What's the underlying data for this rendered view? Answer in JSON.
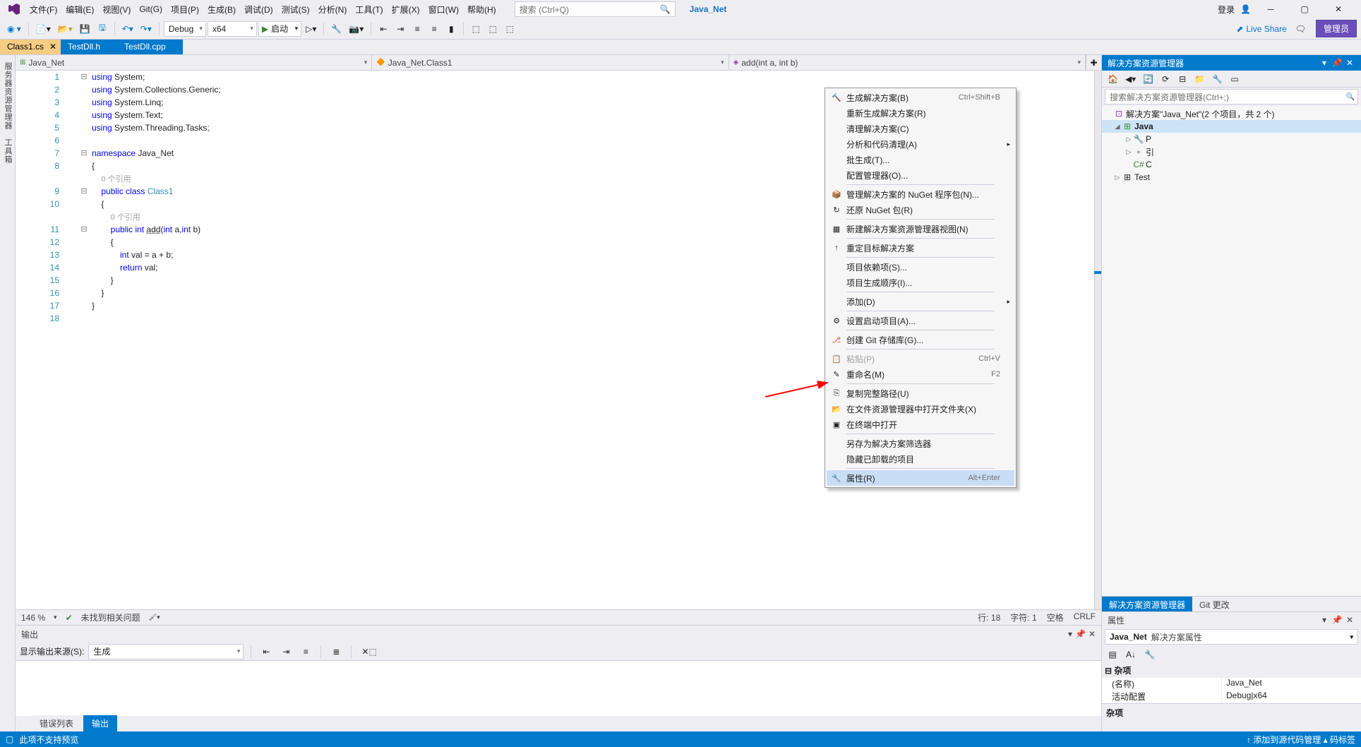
{
  "menu": {
    "file": "文件(F)",
    "edit": "编辑(E)",
    "view": "视图(V)",
    "git": "Git(G)",
    "project": "项目(P)",
    "build": "生成(B)",
    "debug": "调试(D)",
    "test": "测试(S)",
    "analyze": "分析(N)",
    "tools": "工具(T)",
    "extensions": "扩展(X)",
    "window": "窗口(W)",
    "help": "帮助(H)"
  },
  "search_placeholder": "搜索 (Ctrl+Q)",
  "project": "Java_Net",
  "login": "登录",
  "admin": "管理员",
  "live_share": "Live Share",
  "toolbar": {
    "config": "Debug",
    "platform": "x64",
    "start": "启动"
  },
  "tabs": {
    "t1": "Class1.cs",
    "t2": "TestDll.h",
    "t3": "TestDll.cpp"
  },
  "nav": {
    "a": "Java_Net",
    "b": "Java_Net.Class1",
    "c": "add(int a, int b)"
  },
  "code": {
    "l1": "using System;",
    "l2": "using System.Collections.Generic;",
    "l3": "using System.Linq;",
    "l4": "using System.Text;",
    "l5": "using System.Threading.Tasks;",
    "l7": "namespace Java_Net",
    "l8": "{",
    "ref1": "0 个引用",
    "l9": "    public class Class1",
    "l10": "    {",
    "ref2": "0 个引用",
    "l11": "        public int add(int a,int b)",
    "l12": "        {",
    "l13": "            int val = a + b;",
    "l14": "            return val;",
    "l15": "        }",
    "l16": "    }",
    "l17": "}"
  },
  "editor_status": {
    "zoom": "146 %",
    "issues": "未找到相关问题",
    "line": "行: 18",
    "col": "字符: 1",
    "spaces": "空格",
    "crlf": "CRLF"
  },
  "output": {
    "title": "输出",
    "from_label": "显示输出来源(S):",
    "from_value": "生成"
  },
  "bottom_tabs": {
    "errors": "错误列表",
    "output": "输出"
  },
  "status": {
    "preview": "此项不支持预览",
    "right": "↑ 添加到源代码管理 ▴   码标签"
  },
  "left_tabs": {
    "a": "服务器资源管理器",
    "b": "工具箱"
  },
  "se": {
    "title": "解决方案资源管理器",
    "search": "搜索解决方案资源管理器(Ctrl+;)",
    "sol": "解决方案\"Java_Net\"(2 个项目，共 2 个)",
    "proj": "Java",
    "p1": "P",
    "p2": "引",
    "p3": "C",
    "p4": "Test"
  },
  "right_tabs": {
    "se": "解决方案资源管理器",
    "git": "Git 更改"
  },
  "props": {
    "title": "属性",
    "combo": "Java_Net",
    "combo_sub": "解决方案属性",
    "cat": "杂项",
    "name_k": "(名称)",
    "name_v": "Java_Net",
    "cfg_k": "活动配置",
    "cfg_v": "Debug|x64",
    "desc": "杂项"
  },
  "ctx": {
    "build": "生成解决方案(B)",
    "build_sc": "Ctrl+Shift+B",
    "rebuild": "重新生成解决方案(R)",
    "clean": "清理解决方案(C)",
    "analyze": "分析和代码清理(A)",
    "batch": "批生成(T)...",
    "config": "配置管理器(O)...",
    "nuget": "管理解决方案的 NuGet 程序包(N)...",
    "restore": "还原 NuGet 包(R)",
    "newview": "新建解决方案资源管理器视图(N)",
    "retarget": "重定目标解决方案",
    "deps": "项目依赖项(S)...",
    "order": "项目生成顺序(I)...",
    "add": "添加(D)",
    "startup": "设置启动项目(A)...",
    "gitrepo": "创建 Git 存储库(G)...",
    "paste": "粘贴(P)",
    "paste_sc": "Ctrl+V",
    "rename": "重命名(M)",
    "rename_sc": "F2",
    "copypath": "复制完整路径(U)",
    "openfolder": "在文件资源管理器中打开文件夹(X)",
    "terminal": "在终端中打开",
    "saveas": "另存为解决方案筛选器",
    "hide": "隐藏已卸载的项目",
    "props": "属性(R)",
    "props_sc": "Alt+Enter"
  }
}
